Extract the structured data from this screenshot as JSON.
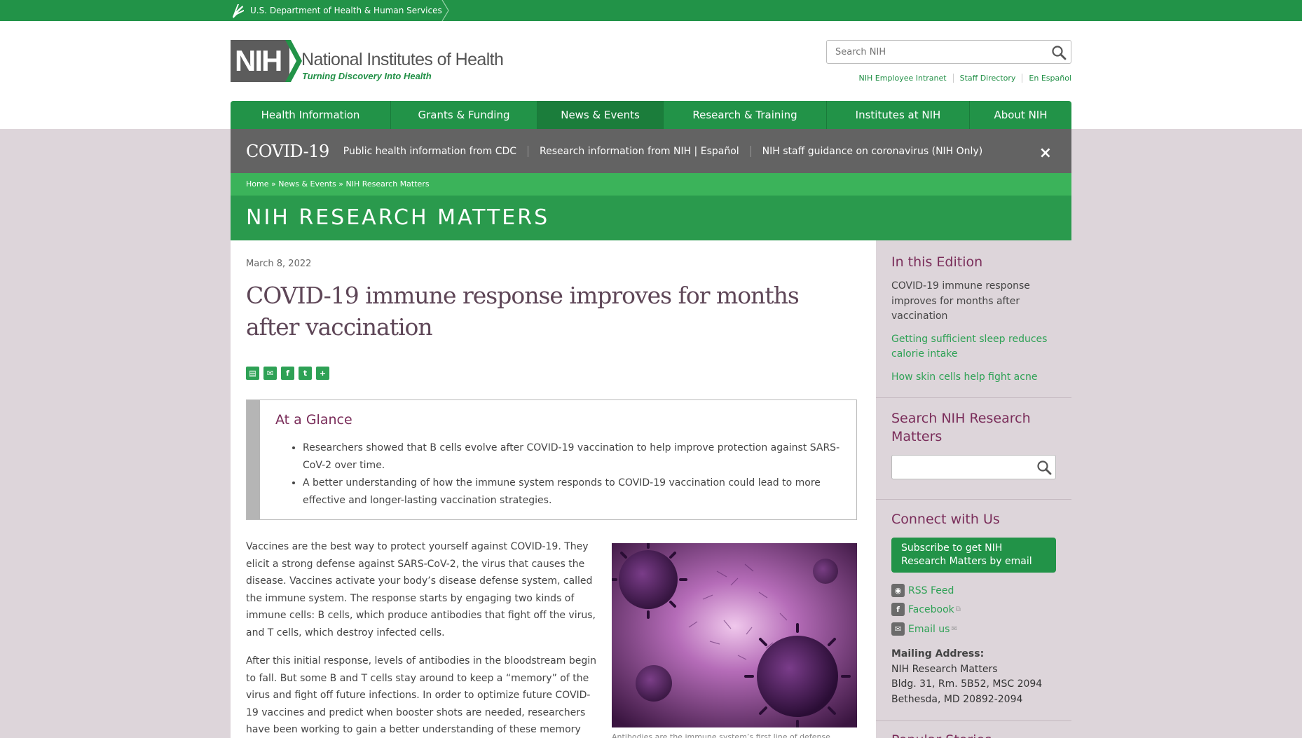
{
  "hhs_bar": {
    "label": "U.S. Department of Health & Human Services"
  },
  "header": {
    "logo_abbr": "NIH",
    "logo_title": "National Institutes of Health",
    "logo_tagline": "Turning Discovery Into Health",
    "search_placeholder": "Search NIH",
    "util_links": [
      "NIH Employee Intranet",
      "Staff Directory",
      "En Español"
    ]
  },
  "nav": {
    "items": [
      "Health Information",
      "Grants & Funding",
      "News & Events",
      "Research & Training",
      "Institutes at NIH",
      "About NIH"
    ],
    "active": "News & Events"
  },
  "covid_bar": {
    "title": "COVID-19",
    "links": [
      "Public health information from CDC",
      "Research information from NIH | Español",
      "NIH staff guidance on coronavirus (NIH Only)"
    ],
    "close": "×"
  },
  "breadcrumb": {
    "home": "Home",
    "sep": "»",
    "section": "News & Events",
    "page": "NIH Research Matters"
  },
  "banner": {
    "title": "NIH RESEARCH MATTERS"
  },
  "article": {
    "date": "March 8, 2022",
    "headline": "COVID-19 immune response improves for months after vaccination",
    "glance_title": "At a Glance",
    "glance_points": [
      "Researchers showed that B cells evolve after COVID-19 vaccination to help improve protection against SARS-CoV-2 over time.",
      "A better understanding of how the immune system responds to COVID-19 vaccination could lead to more effective and longer-lasting vaccination strategies."
    ],
    "paragraphs": [
      "Vaccines are the best way to protect yourself against COVID-19. They elicit a strong defense against SARS-CoV-2, the virus that causes the disease. Vaccines activate your body’s disease defense system, called the immune system. The response starts by engaging two kinds of immune cells: B cells, which produce antibodies that fight off the virus, and T cells, which destroy infected cells.",
      "After this initial response, levels of antibodies in the bloodstream begin to fall. But some B and T cells stay around to keep a “memory” of the virus and fight off future infections. In order to optimize future COVID-19 vaccines and predict when booster shots are needed, researchers have been working to gain a better understanding of these memory cells."
    ],
    "caption": "Antibodies are the immune system’s first line of defense"
  },
  "sidebar": {
    "edition_title": "In this Edition",
    "edition_current": "COVID-19 immune response improves for months after vaccination",
    "edition_links": [
      "Getting sufficient sleep reduces calorie intake",
      "How skin cells help fight acne"
    ],
    "search_title": "Search NIH Research Matters",
    "connect_title": "Connect with Us",
    "subscribe": "Subscribe to get NIH Research Matters by email",
    "rss": "RSS Feed",
    "facebook": "Facebook",
    "email": "Email us",
    "mailing_label": "Mailing Address:",
    "mailing_lines": [
      "NIH Research Matters",
      "Bldg. 31, Rm. 5B52, MSC 2094",
      "Bethesda, MD 20892-2094"
    ],
    "next_title": "Popular Stories"
  },
  "colors": {
    "green": "#229348",
    "purple_heading": "#7a2d5a",
    "covid_gray": "#636363"
  }
}
